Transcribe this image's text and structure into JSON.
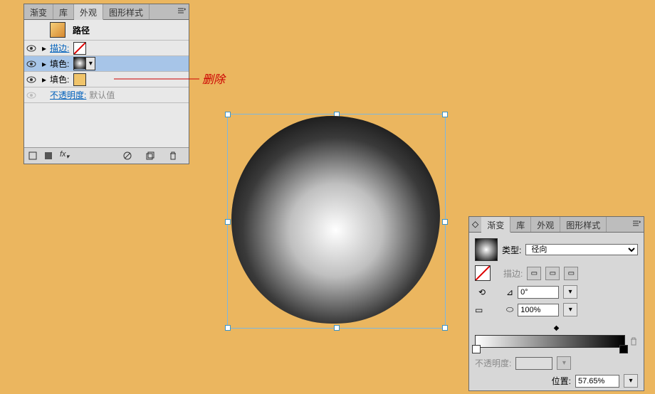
{
  "appearance_panel": {
    "tabs": [
      "渐变",
      "库",
      "外观",
      "图形样式"
    ],
    "active_tab": 2,
    "object_label": "路径",
    "rows": [
      {
        "label": "描边:",
        "link": true
      },
      {
        "label": "填色:"
      },
      {
        "label": "填色:"
      }
    ],
    "opacity_row": {
      "label": "不透明度:",
      "value": "默认值"
    },
    "fx_label": "fx"
  },
  "callout": "删除",
  "gradient_panel": {
    "tabs": [
      "渐变",
      "库",
      "外观",
      "图形样式"
    ],
    "active_tab": 0,
    "type_label": "类型:",
    "type_value": "径向",
    "stroke_label": "描边:",
    "angle_value": "0°",
    "ar_value": "100%",
    "opacity_label": "不透明度:",
    "position_label": "位置:",
    "position_value": "57.65%"
  },
  "chart_data": {
    "type": "other",
    "title": "Radial gradient sphere preview with Appearance and Gradient panels",
    "note": "Illustrator UI screenshot; no quantitative chart data"
  }
}
